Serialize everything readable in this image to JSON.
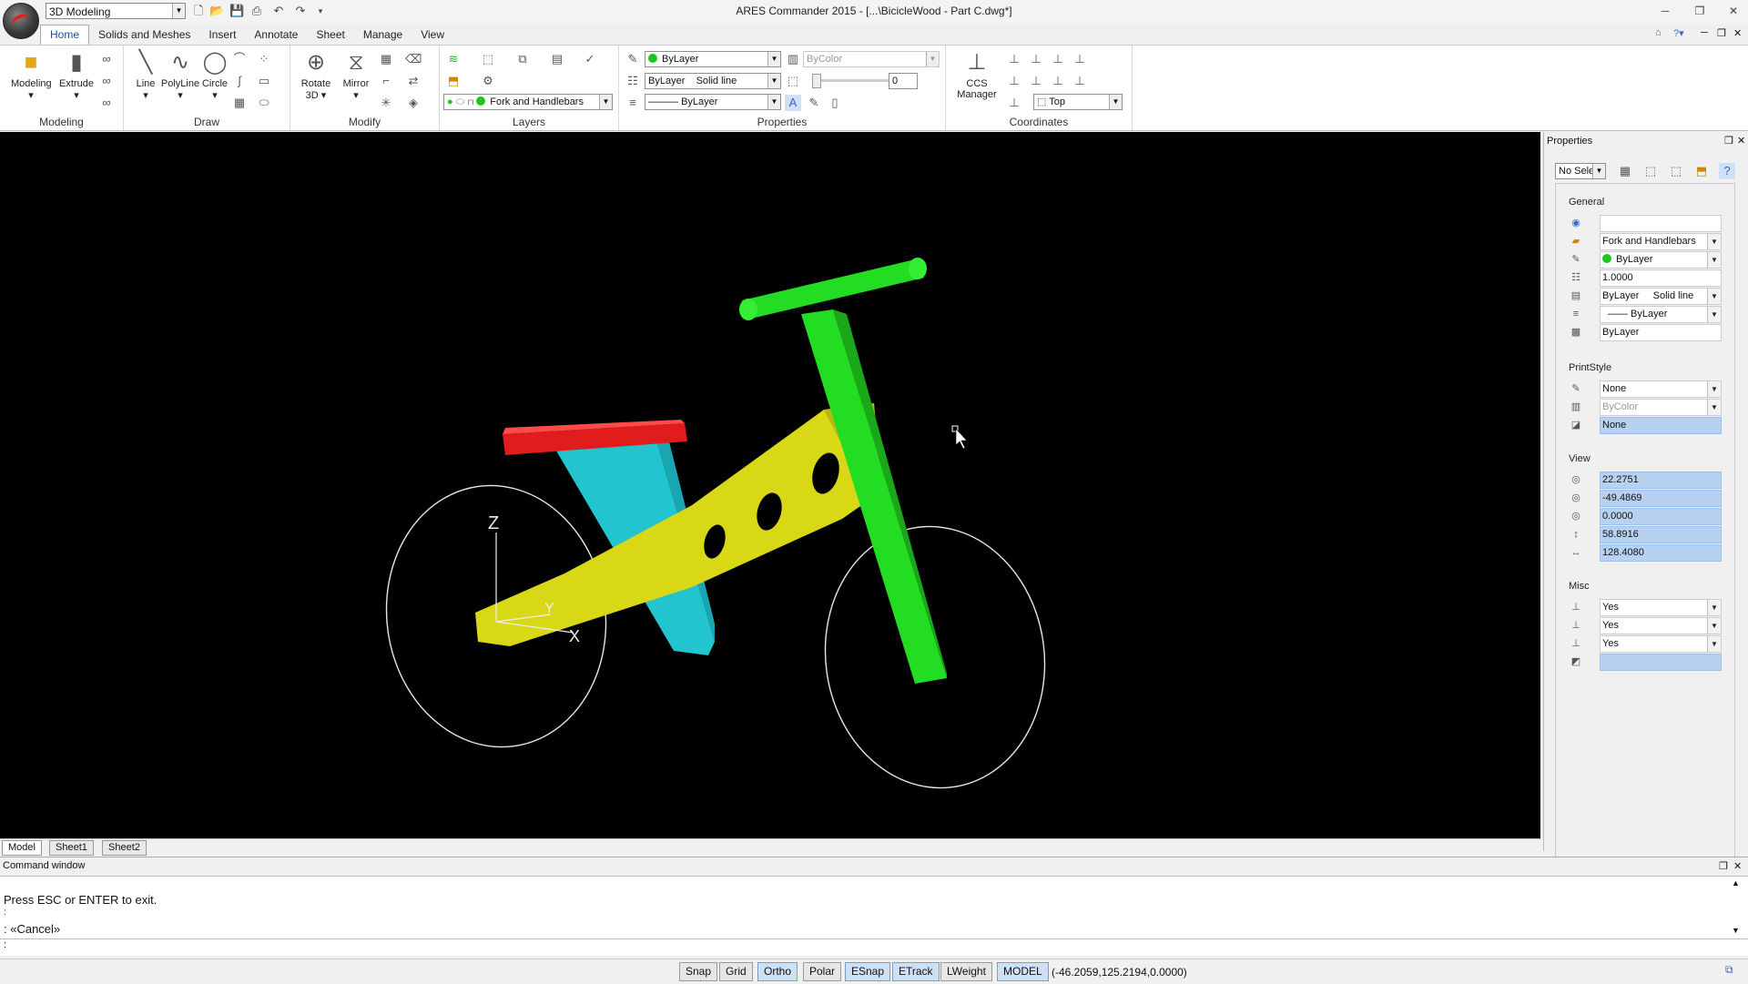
{
  "window": {
    "title": "ARES Commander 2015 - [...\\BicicleWood - Part C.dwg*]",
    "workspace": "3D Modeling"
  },
  "tabs": [
    "Home",
    "Solids and Meshes",
    "Insert",
    "Annotate",
    "Sheet",
    "Manage",
    "View"
  ],
  "ribbon": {
    "modeling": {
      "label": "Modeling",
      "modeling_btn": "Modeling",
      "extrude_btn": "Extrude"
    },
    "draw": {
      "label": "Draw",
      "line_btn": "Line",
      "polyline_btn": "PolyLine",
      "circle_btn": "Circle"
    },
    "modify": {
      "label": "Modify",
      "rotate_btn_l1": "Rotate",
      "rotate_btn_l2": "3D",
      "mirror_btn": "Mirror"
    },
    "layers": {
      "label": "Layers",
      "current_layer": "Fork and Handlebars"
    },
    "properties": {
      "label": "Properties",
      "color": "ByLayer",
      "printstyle": "ByColor",
      "linestyle_a": "ByLayer",
      "linestyle_b": "Solid line",
      "lineweight": "ByLayer",
      "transparency": "0"
    },
    "coordinates": {
      "label": "Coordinates",
      "ccs_btn_l1": "CCS",
      "ccs_btn_l2": "Manager",
      "view": "Top"
    }
  },
  "viewport": {
    "axis_z": "Z",
    "axis_y": "Y",
    "axis_x": "X"
  },
  "sheet_tabs": [
    "Model",
    "Sheet1",
    "Sheet2"
  ],
  "properties": {
    "title": "Properties",
    "selection": "No Sele",
    "general_label": "General",
    "general": [
      "",
      "Fork and Handlebars",
      "ByLayer",
      "1.0000",
      "ByLayer     Solid line",
      "—— ByLayer",
      "ByLayer"
    ],
    "printstyle_label": "PrintStyle",
    "printstyle": [
      "None",
      "ByColor",
      "None"
    ],
    "view_label": "View",
    "view": [
      "22.2751",
      "-49.4869",
      "0.0000",
      "58.8916",
      "128.4080"
    ],
    "misc_label": "Misc",
    "misc": [
      "Yes",
      "Yes",
      "Yes",
      ""
    ]
  },
  "command": {
    "title": "Command window",
    "lines": [
      "Press ESC or ENTER to exit.",
      ":",
      ": «Cancel»",
      ":"
    ]
  },
  "status": {
    "buttons": [
      "Snap",
      "Grid",
      "Ortho",
      "Polar",
      "ESnap",
      "ETrack",
      "LWeight",
      "MODEL"
    ],
    "coords": "(-46.2059,125.2194,0.0000)"
  }
}
